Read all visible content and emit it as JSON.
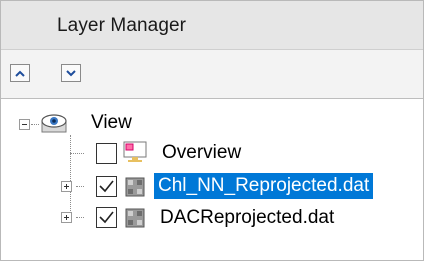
{
  "panel": {
    "title": "Layer Manager"
  },
  "toolbar": {
    "buttons": [
      {
        "icon": "chevron-up-icon"
      },
      {
        "icon": "chevron-down-icon"
      }
    ]
  },
  "tree": {
    "root": {
      "label": "View",
      "expanded": true,
      "icon": "eye-icon"
    },
    "items": [
      {
        "label": "Overview",
        "checked": false,
        "icon": "monitor-icon",
        "selected": false
      },
      {
        "label": "Chl_NN_Reprojected.dat",
        "checked": true,
        "icon": "raster-layer-icon",
        "selected": true,
        "expanded": false
      },
      {
        "label": "DACReprojected.dat",
        "checked": true,
        "icon": "raster-layer-icon",
        "selected": false,
        "expanded": false
      }
    ]
  },
  "colors": {
    "selection": "#0078d7",
    "titlebar": "#e6e6e6",
    "toolbar": "#f3f3f3"
  }
}
